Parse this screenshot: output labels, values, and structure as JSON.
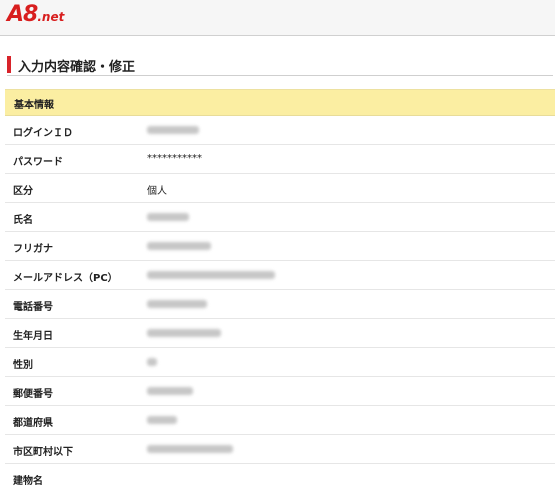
{
  "logo": {
    "main": "A8",
    "suffix": ".net"
  },
  "page": {
    "title": "入力内容確認・修正"
  },
  "section": {
    "title": "基本情報"
  },
  "rows": [
    {
      "label": "ログインＩＤ",
      "value": null,
      "masked": true
    },
    {
      "label": "パスワード",
      "value": "***********",
      "masked": false
    },
    {
      "label": "区分",
      "value": "個人",
      "masked": false
    },
    {
      "label": "氏名",
      "value": null,
      "masked": true
    },
    {
      "label": "フリガナ",
      "value": null,
      "masked": true
    },
    {
      "label": "メールアドレス（PC）",
      "value": null,
      "masked": true
    },
    {
      "label": "電話番号",
      "value": null,
      "masked": true
    },
    {
      "label": "生年月日",
      "value": null,
      "masked": true
    },
    {
      "label": "性別",
      "value": null,
      "masked": true
    },
    {
      "label": "郵便番号",
      "value": null,
      "masked": true
    },
    {
      "label": "都道府県",
      "value": null,
      "masked": true
    },
    {
      "label": "市区町村以下",
      "value": null,
      "masked": true
    },
    {
      "label": "建物名",
      "value": null,
      "masked": false
    }
  ],
  "colors": {
    "accent": "#d8232a",
    "section_bg": "#fbeea2",
    "logo": "#d81e1e"
  }
}
